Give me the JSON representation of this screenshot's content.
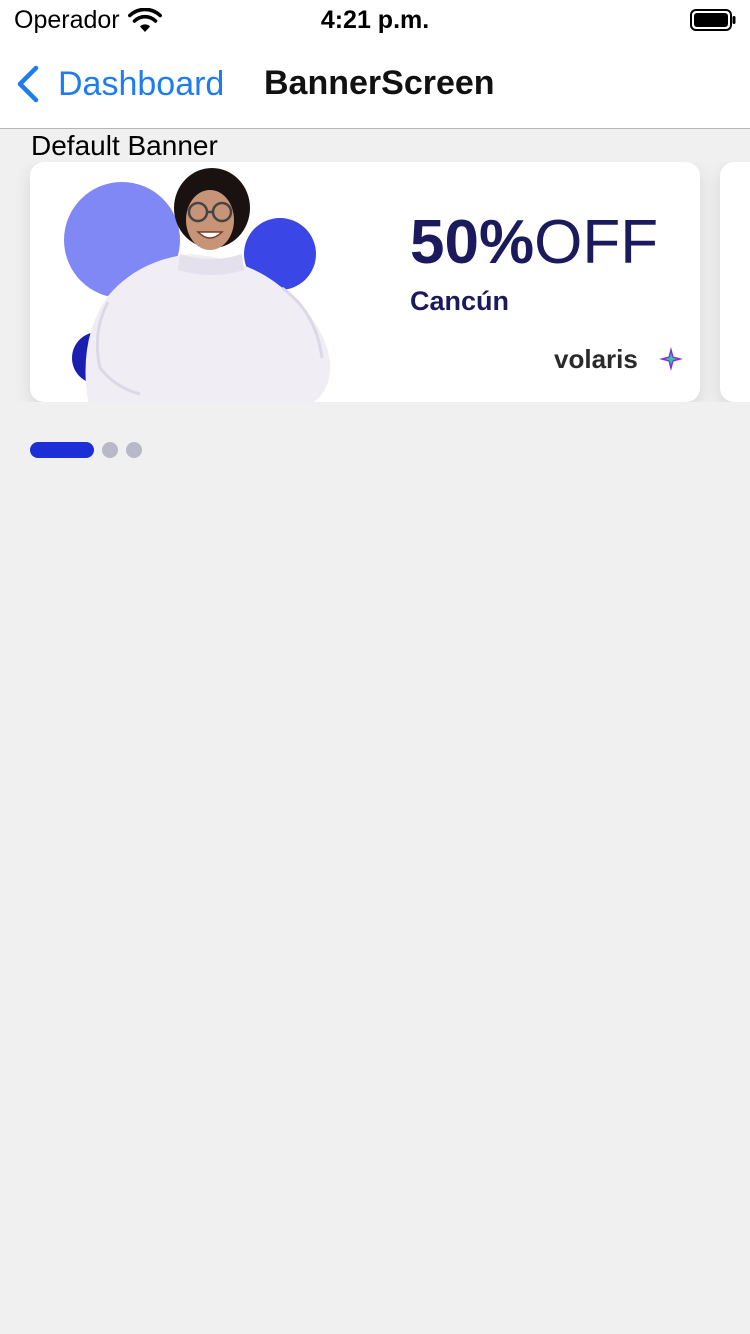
{
  "status_bar": {
    "carrier": "Operador",
    "time": "4:21 p.m."
  },
  "nav": {
    "back_label": "Dashboard",
    "title": "BannerScreen"
  },
  "section": {
    "label": "Default Banner"
  },
  "banner": {
    "discount_percent": "50%",
    "discount_suffix": "OFF",
    "destination": "Cancún",
    "brand": "volaris"
  },
  "pager": {
    "page_count": 3,
    "active_index": 0
  },
  "colors": {
    "accent_blue": "#1f7cf0",
    "pager_active": "#1c2fd6",
    "pager_inactive": "#b8b8c8",
    "banner_text": "#1a1a5c",
    "background": "#f0f0f0"
  },
  "icons": {
    "status": [
      "wifi-icon",
      "battery-icon"
    ],
    "nav": [
      "chevron-left-icon"
    ],
    "brand": "volaris-sparkle-icon"
  }
}
